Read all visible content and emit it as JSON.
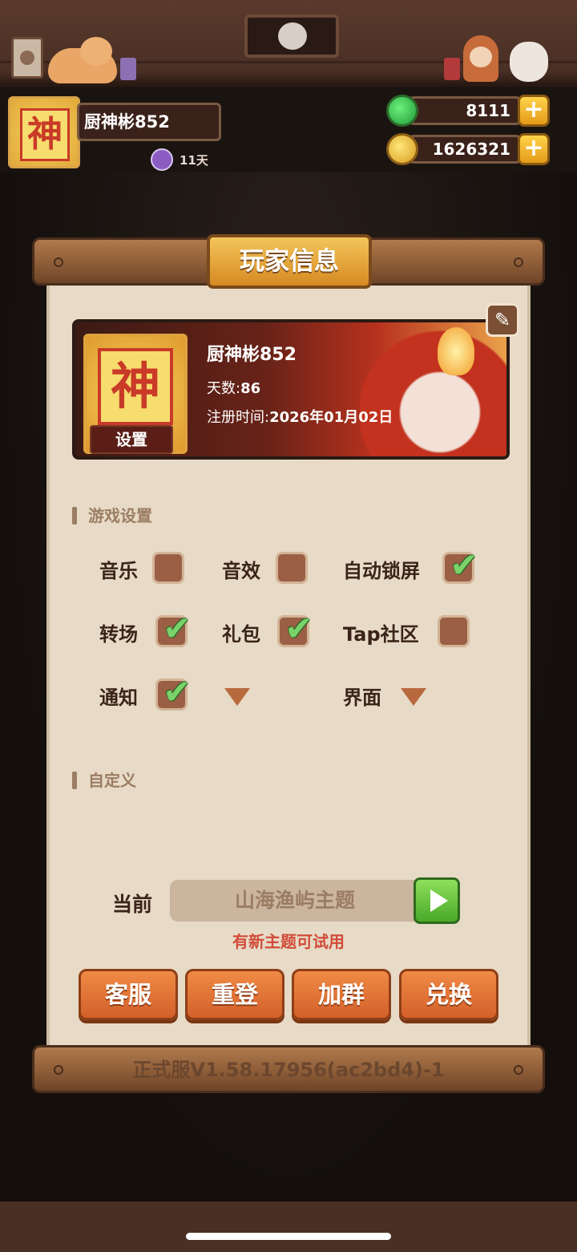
{
  "user": {
    "name": "厨神彬852",
    "days_badge": "11天",
    "currency": {
      "jade": "8111",
      "coins": "1626321",
      "add_symbol": "+"
    }
  },
  "panel": {
    "title": "玩家信息",
    "profile": {
      "name": "厨神彬852",
      "days_label": "天数:",
      "days_value": "86",
      "reg_label": "注册时间:",
      "reg_value": "2026年01月02日",
      "settings_tag": "设置",
      "avatar_char": "神"
    },
    "game_settings": {
      "title": "游戏设置",
      "options": [
        {
          "label": "音乐",
          "checked": false
        },
        {
          "label": "音效",
          "checked": false
        },
        {
          "label": "自动锁屏",
          "checked": true
        },
        {
          "label": "转场",
          "checked": true
        },
        {
          "label": "礼包",
          "checked": true
        },
        {
          "label": "Tap社区",
          "checked": false
        },
        {
          "label": "通知",
          "checked": true
        }
      ],
      "interface_label": "界面"
    },
    "custom": {
      "title": "自定义",
      "current_label": "当前",
      "theme_value": "山海渔屿主题",
      "new_theme_hint": "有新主题可试用"
    },
    "buttons": {
      "service": "客服",
      "relogin": "重登",
      "join_group": "加群",
      "redeem": "兑换"
    },
    "version": "正式服V1.58.17956(ac2bd4)-1"
  },
  "colors": {
    "accent_orange": "#d2602a",
    "check_green": "#7ad36a",
    "hint_red": "#d24b3a",
    "paper": "#e7dac6"
  },
  "icons": [
    "edit-icon",
    "jade-icon",
    "coin-icon",
    "plus-icon",
    "play-icon",
    "check-icon",
    "dropdown-icon"
  ]
}
